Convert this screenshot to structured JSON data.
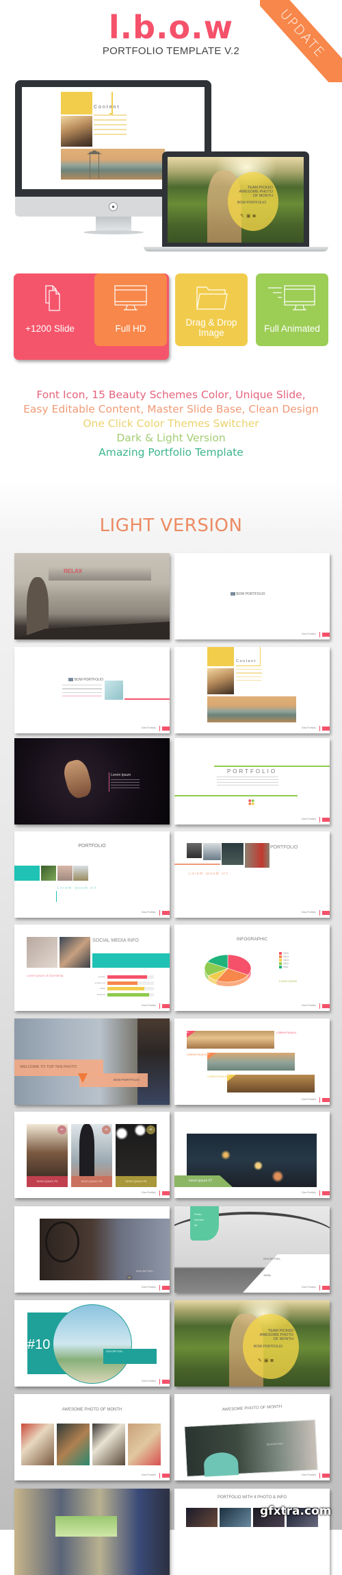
{
  "header": {
    "logo": "l.b.o.w",
    "subtitle": "PORTFOLIO TEMPLATE V.2",
    "ribbon": "UPDATE",
    "colors": {
      "logo": "#f5516a",
      "ribbon": "#f7874a"
    }
  },
  "showcase": {
    "desktop_slide": {
      "title": "Content"
    },
    "laptop_slide": {
      "title_lines": [
        "TEAM PICKED",
        "AWESOME PHOTO",
        "OF MONTH"
      ],
      "brand": "BOW PORTFOLIO",
      "icons": [
        "edit-icon",
        "image-icon",
        "camera-icon"
      ]
    }
  },
  "features": [
    {
      "label": "+1200 Slide",
      "icon": "documents-icon",
      "color": "#f5556b"
    },
    {
      "label": "Full HD",
      "icon": "monitor-icon",
      "color": "#f7874a"
    },
    {
      "label": "Drag & Drop Image",
      "icon": "folder-icon",
      "color": "#f1cc4c"
    },
    {
      "label": "Full Animated",
      "icon": "animated-monitor-icon",
      "color": "#9ccd55"
    }
  ],
  "tagline": [
    {
      "text": "Font Icon, 15 Beauty Schemes Color, Unique Slide,",
      "color": "#e5637c"
    },
    {
      "text": "Easy Editable Content, Master Slide Base, Clean Design",
      "color": "#ef9a76"
    },
    {
      "text": "One Click Color Themes Switcher",
      "color": "#ebd26c"
    },
    {
      "text": "Dark & Light Version",
      "color": "#a3cd74"
    },
    {
      "text": "Amazing Portfolio Template",
      "color": "#3cb68c"
    }
  ],
  "section_title": "LIGHT VERSION",
  "slide_footer": "Bow Portfolio",
  "slides": {
    "s1": {
      "overlay": "RELAX"
    },
    "s2": {
      "brand": "BOW PORTFOLIO"
    },
    "s3": {
      "brand": "BOW PORTFOLIO"
    },
    "s4": {
      "title": "Content"
    },
    "s5": {
      "title": "Lorem Ipsum"
    },
    "s6": {
      "title": "PORTFOLIO"
    },
    "s7": {
      "title": "PORTFOLIO",
      "subtitle": "Lorem ipsum sit"
    },
    "s8": {
      "title": "PORTFOLIO",
      "subtitle": "Lorem ipsum sit ."
    },
    "s9": {
      "title": "SOCIAL MEDIA INFO",
      "subtitle": "Lorem Ipsum of Diceriwhat",
      "bars": [
        {
          "label": "youtube",
          "value": 0.85,
          "color": "#f5516a"
        },
        {
          "label": "google plus",
          "value": 0.65,
          "color": "#f7874a"
        },
        {
          "label": "twitter",
          "value": 0.8,
          "color": "#f1cc4c"
        },
        {
          "label": "facebook",
          "value": 0.9,
          "color": "#8fcb4f"
        }
      ]
    },
    "s10": {
      "title": "INFOGRAPHIC",
      "subtitle": "Lorem Ipsum",
      "legend": [
        {
          "label": "2015",
          "color": "#f5516a",
          "share": 0.33
        },
        {
          "label": "2014",
          "color": "#f7874a",
          "share": 0.25
        },
        {
          "label": "2013",
          "color": "#f1cc4c",
          "share": 0.08
        },
        {
          "label": "2012",
          "color": "#8fcb4f",
          "share": 0.17
        },
        {
          "label": "2011",
          "color": "#1fb37c",
          "share": 0.17
        }
      ]
    },
    "s11": {
      "title": "WELCOME TO TOP TEN PHOTO",
      "brand": "BOW PORTFOLIO"
    },
    "s12": {
      "badges": [
        "#1",
        "#2",
        "#3"
      ],
      "headings": [
        "LOREM IPSUM #1",
        "LOREM IPSUM #2",
        "LOREM IPSUM #3"
      ]
    },
    "s13": {
      "cards": [
        {
          "badge": "#4",
          "label": "lorem ipsum #4",
          "color": "#c0404f"
        },
        {
          "badge": "#5",
          "label": "lorem ipsum #5",
          "color": "#c9715e"
        },
        {
          "badge": "#6",
          "label": "lorem ipsum #6",
          "color": "#a9983a"
        }
      ]
    },
    "s14": {
      "label": "lorem ipsum #7"
    },
    "s15": {
      "heading": "DESCRIPTION...",
      "badge": "#8"
    },
    "s16": {
      "tag_lines": [
        "Photo",
        "Number",
        "#9"
      ],
      "heading": "DESCRIPTION...",
      "value": "1500s"
    },
    "s17": {
      "number": "#10",
      "heading": "DESCRIPTION"
    },
    "s18": {
      "title_lines": [
        "TEAM PICKED",
        "AWESOME PHOTO",
        "OF MONTH"
      ],
      "brand": "BOW PORTFOLIO"
    },
    "s19": {
      "title": "AWESOME PHOTO OF MONTH"
    },
    "s20": {
      "title": "AWESOME PHOTO OF MONTH",
      "heading": "DESCRIPTION"
    },
    "s22": {
      "title": "PORTFOLIO WITH 4 PHOTO & INFO"
    }
  },
  "watermark": "gfxtra.com"
}
